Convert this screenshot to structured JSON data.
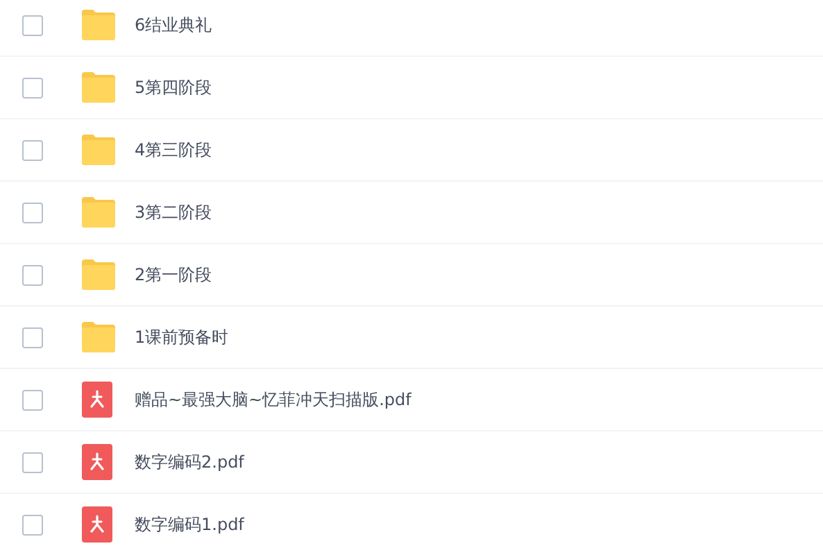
{
  "files": [
    {
      "kind": "folder",
      "name": "6结业典礼",
      "checked": false
    },
    {
      "kind": "folder",
      "name": "5第四阶段",
      "checked": false
    },
    {
      "kind": "folder",
      "name": "4第三阶段",
      "checked": false
    },
    {
      "kind": "folder",
      "name": "3第二阶段",
      "checked": false
    },
    {
      "kind": "folder",
      "name": "2第一阶段",
      "checked": false
    },
    {
      "kind": "folder",
      "name": "1课前预备时",
      "checked": false
    },
    {
      "kind": "pdf",
      "name": "赠品~最强大脑~忆菲冲天扫描版.pdf",
      "checked": false
    },
    {
      "kind": "pdf",
      "name": "数字编码2.pdf",
      "checked": false
    },
    {
      "kind": "pdf",
      "name": "数字编码1.pdf",
      "checked": false
    }
  ]
}
